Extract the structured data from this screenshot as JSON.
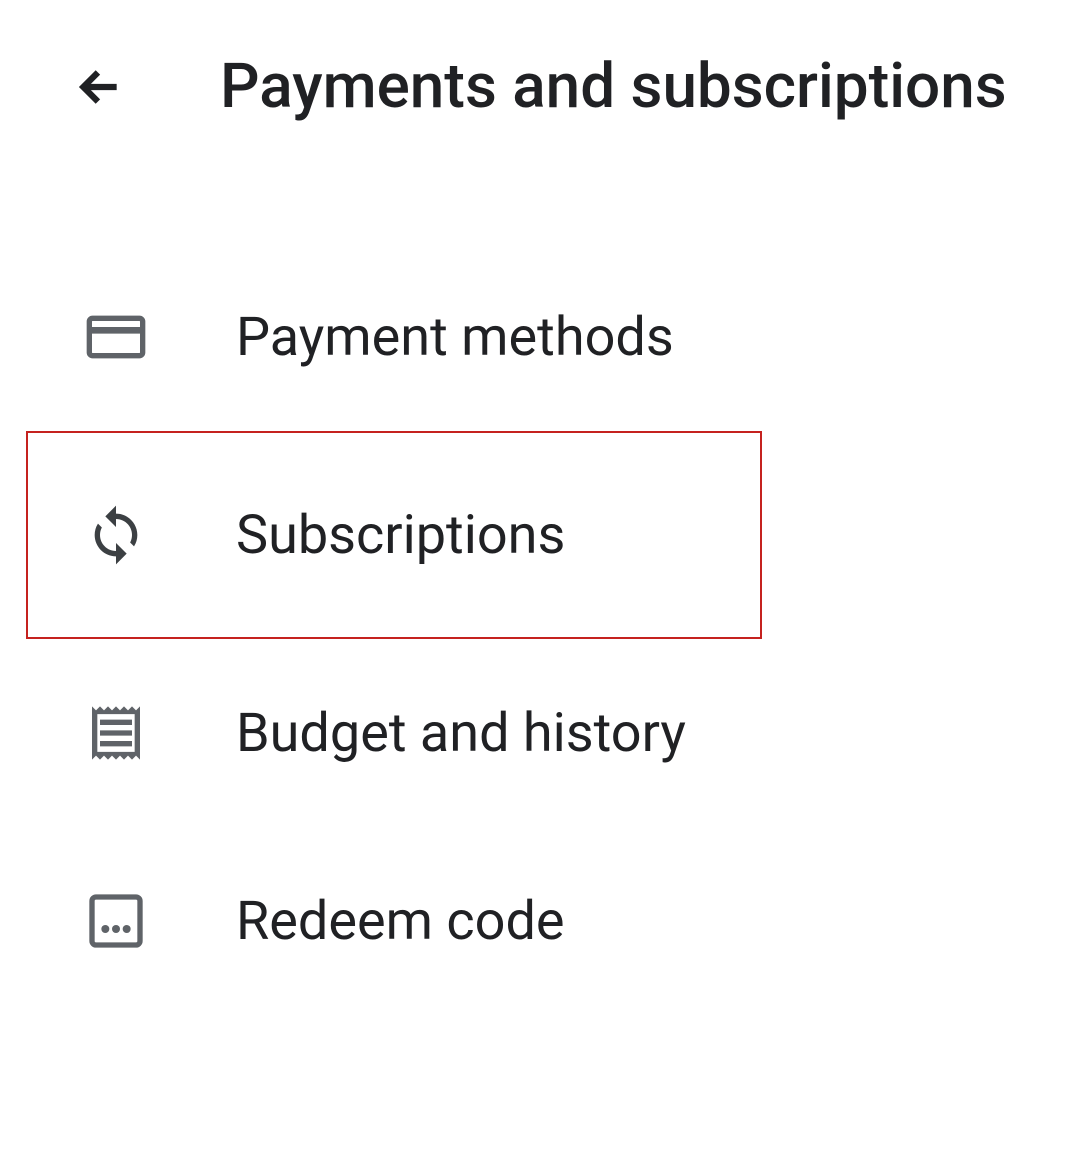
{
  "header": {
    "title": "Payments and subscriptions"
  },
  "menu": {
    "items": [
      {
        "id": "payment-methods",
        "label": "Payment methods"
      },
      {
        "id": "subscriptions",
        "label": "Subscriptions",
        "highlighted": true
      },
      {
        "id": "budget-history",
        "label": "Budget and history"
      },
      {
        "id": "redeem-code",
        "label": "Redeem code"
      }
    ]
  },
  "colors": {
    "text": "#202124",
    "icon": "#5f6368",
    "highlight_border": "#c5221f"
  }
}
